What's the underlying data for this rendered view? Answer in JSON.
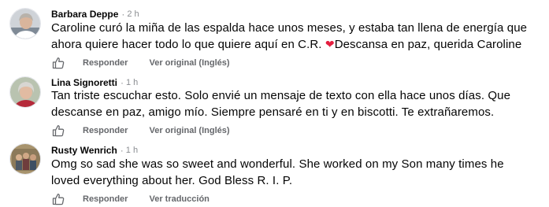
{
  "comments": [
    {
      "author": "Barbara Deppe",
      "time": "2 h",
      "text_lines": [
        "Caroline curó la miña de las espalda hace unos meses, y estaba tan llena de energía que",
        "ahora quiere hacer todo lo que quiere aquí en C.R.",
        "Descansa en paz, querida Caroline"
      ],
      "heart_icon": "red-heart-emoji",
      "reply_label": "Responder",
      "translate_label": "Ver original (Inglés)"
    },
    {
      "author": "Lina Signoretti",
      "time": "1 h",
      "text_lines": [
        "Tan triste escuchar esto. Solo envié un mensaje de texto con ella hace unos días. Que",
        "descanse en paz, amigo mío. Siempre pensaré en ti y en biscotti. Te extrañaremos."
      ],
      "reply_label": "Responder",
      "translate_label": "Ver original (Inglés)"
    },
    {
      "author": "Rusty Wenrich",
      "time": "1 h",
      "text_lines": [
        "Omg so sad she was so sweet and wonderful. She worked on my Son many times he",
        "loved everything about her. God Bless R. I. P."
      ],
      "reply_label": "Responder",
      "translate_label": "Ver traducción"
    }
  ],
  "separator": "·",
  "like_icon": "thumbs-up-outline-icon",
  "colors": {
    "name": "#050505",
    "meta": "#8a8d91",
    "action": "#65676b",
    "heart": "#e41e3f"
  }
}
